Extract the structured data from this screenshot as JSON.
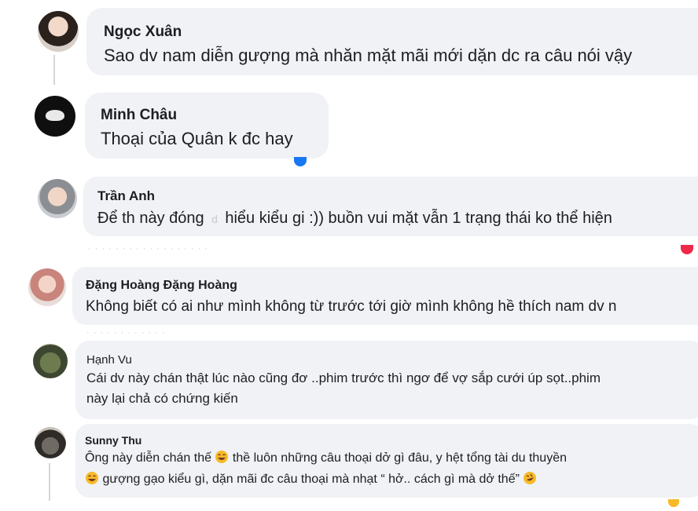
{
  "comments": [
    {
      "author": "Ngọc Xuân",
      "text": "Sao dv nam diễn gượng mà nhăn mặt mãi mới dặn dc ra câu nói vậy"
    },
    {
      "author": "Minh Châu",
      "text": "Thoại của Quân k đc hay"
    },
    {
      "author": "Trần Anh",
      "text_a": "Để th này đóng",
      "text_b": "hiểu kiểu gi :)) buồn vui mặt vẫn 1 trạng thái ko thể hiện"
    },
    {
      "author": "Đặng Hoàng Đặng Hoàng",
      "text": "Không biết có ai như mình không từ trước tới giờ mình không hề thích nam dv n"
    },
    {
      "author": "Hạnh Vu",
      "line1": "Cái dv này chán thật lúc nào cũng đơ ..phim trước thì ngơ để vợ sắp cưới úp sọt..phim",
      "line2": "này lại chả có chứng kiến"
    },
    {
      "author": "Sunny Thu",
      "line1_a": "Ông này diễn chán thế",
      "line1_b": "thề luôn những câu thoại dở gì đâu, y hệt tổng tài du thuyền",
      "line2_a": "gượng gạo kiểu gì, dặn mãi đc câu thoại mà nhạt “ hở.. cách gì mà dở thế”"
    }
  ],
  "colors": {
    "bubble": "#f0f2f5",
    "text": "#1c1e21",
    "muted": "#65676b",
    "reaction_blue": "#1877f2",
    "reaction_red": "#f02849"
  }
}
